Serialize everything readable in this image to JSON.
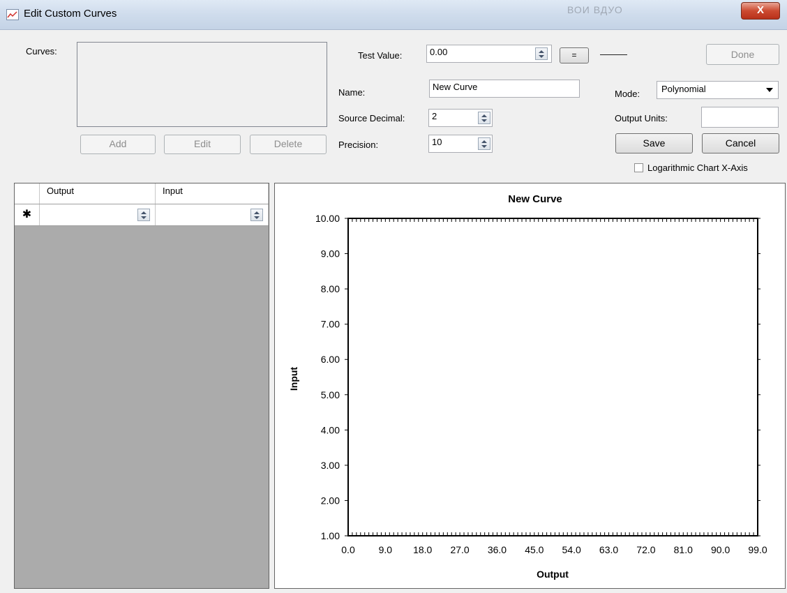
{
  "window": {
    "title": "Edit Custom Curves",
    "blurred_title_text": "ВОИ ВДУО",
    "close_glyph": "X"
  },
  "curves": {
    "label": "Curves:",
    "items": [],
    "add_label": "Add",
    "edit_label": "Edit",
    "delete_label": "Delete"
  },
  "test": {
    "label": "Test Value:",
    "value": "0.00",
    "equals_label": "=",
    "result": "———"
  },
  "done_label": "Done",
  "fields": {
    "name_label": "Name:",
    "name_value": "New Curve",
    "source_decimal_label": "Source Decimal:",
    "source_decimal_value": "2",
    "precision_label": "Precision:",
    "precision_value": "10"
  },
  "mode": {
    "label": "Mode:",
    "selected": "Polynomial"
  },
  "output_units": {
    "label": "Output Units:",
    "value": ""
  },
  "save_label": "Save",
  "cancel_label": "Cancel",
  "log_checkbox": {
    "label": "Logarithmic Chart X-Axis",
    "checked": false
  },
  "grid": {
    "columns": [
      "Output",
      "Input"
    ],
    "new_row_marker": "✱"
  },
  "chart_data": {
    "type": "line",
    "title": "New Curve",
    "xlabel": "Output",
    "ylabel": "Input",
    "xlim": [
      0,
      99
    ],
    "ylim": [
      1,
      10
    ],
    "xticks": [
      "0.0",
      "9.0",
      "18.0",
      "27.0",
      "36.0",
      "45.0",
      "54.0",
      "63.0",
      "72.0",
      "81.0",
      "90.0",
      "99.0"
    ],
    "yticks": [
      "10.00",
      "9.00",
      "8.00",
      "7.00",
      "6.00",
      "5.00",
      "4.00",
      "3.00",
      "2.00",
      "1.00"
    ],
    "series": []
  }
}
